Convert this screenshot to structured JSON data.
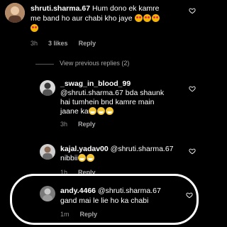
{
  "comments": [
    {
      "user": "shruti.sharma.67",
      "text_line1": "Hum dono ek kamre",
      "text_line2": "me band ho aur chabi kho jaye",
      "time": "3h",
      "likes": "3 likes",
      "reply": "Reply"
    },
    {
      "user": "_swag_in_blood_99",
      "text_line1": "@shruti.sharma.67 bda shaunk",
      "text_line2": "hai tumhein bnd kamre main",
      "text_line3": "jaane ka",
      "time": "3h",
      "reply": "Reply"
    },
    {
      "user": "kajal.yadav00",
      "text_line1": "@shruti.sharma.67",
      "text_line2": "nibbii",
      "time": "1h",
      "reply": "Reply"
    },
    {
      "user": "andy.4466",
      "text_line1": "@shruti.sharma.67",
      "text_line2": "gand mai le lie ho ka chabi",
      "time": "1m",
      "reply": "Reply"
    }
  ],
  "view_replies": "View previous replies (2)",
  "icons": {
    "like": "heart-outline-icon"
  }
}
